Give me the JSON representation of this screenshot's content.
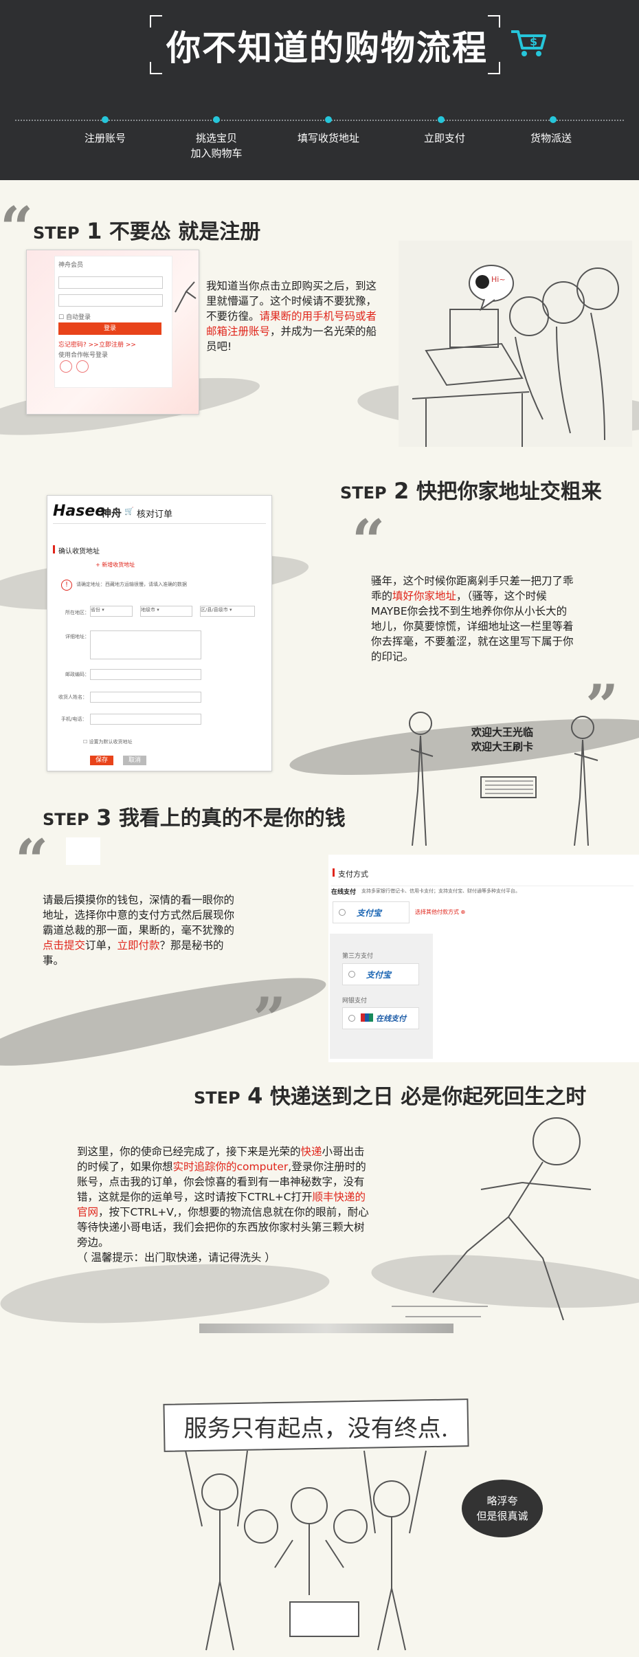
{
  "header": {
    "title": "你不知道的购物流程",
    "cart_icon": "shopping-cart-icon",
    "accent_color": "#26c6da",
    "steps": [
      {
        "label": "注册账号"
      },
      {
        "label": "挑选宝贝",
        "label2": "加入购物车"
      },
      {
        "label": "填写收货地址"
      },
      {
        "label": "立即支付"
      },
      {
        "label": "货物派送"
      }
    ]
  },
  "step1": {
    "step_word": "STEP",
    "num": "1",
    "title": "不要怂 就是注册",
    "text_a": "我知道当你点击立即购买之后，到这里就懵逼了。这个时候请不要犹豫，不要彷徨。",
    "text_red": "请果断的用手机号码或者邮箱注册账号",
    "text_b": "，并成为一名光荣的船员吧!",
    "shot": {
      "member_label": "神舟会员",
      "auto_login": "自动登录",
      "login_button": "登录",
      "forgot": "忘记密码? >>",
      "register": "立即注册 >>",
      "partner": "使用合作帐号登录"
    },
    "qq_label": "Hi~"
  },
  "step2": {
    "step_word": "STEP",
    "num": "2",
    "title": "快把你家地址交粗来",
    "text_a": "骚年，这个时候你距离剁手只差一把刀了乖乖的",
    "text_red": "填好你家地址",
    "text_b": "，（骚等，这个时候MAYBE你会找不到生地养你你从小长大的地儿，你莫要惊慌，详细地址这一栏里等着你去挥毫，不要羞涩，就在这里写下属于你的印记。",
    "shot": {
      "brand": "Hasee",
      "brand_cn": "神舟",
      "check_order": "核对订单",
      "section": "确认收货地址",
      "new_address": "+ 新增收货地址",
      "notice": "请确定地址：西藏地方运输很慢，请填入准确的数据",
      "region_label": "所在地区：",
      "province": "省份",
      "city": "地级市",
      "district": "区/县/县级市",
      "detail_label": "详细地址：",
      "zip_label": "邮政编码：",
      "name_label": "收货人姓名：",
      "phone_label": "手机/电话：",
      "default_label": "设置为默认收货地址",
      "save": "保存",
      "cancel": "取消"
    },
    "welcome_1": "欢迎大王光临",
    "welcome_2": "欢迎大王刷卡"
  },
  "step3": {
    "step_word": "STEP",
    "num": "3",
    "title": "我看上的真的不是你的钱",
    "text_a": "请最后摸摸你的钱包，深情的看一眼你的地址，选择你中意的支付方式然后展现你霸道总裁的那一面，果断的，毫不犹豫的",
    "text_red1": "点击提交",
    "text_b": "订单，",
    "text_red2": "立即付款",
    "text_c": "？那是秘书的事。",
    "shot": {
      "section": "支付方式",
      "online_label": "在线支付",
      "online_desc": "支持多家银行借记卡、信用卡支付；支持支付宝、财付通等多种支付平台。",
      "alipay": "支付宝",
      "choose_other": "选择其他付款方式",
      "third_party": "第三方支付",
      "bank_pay": "网银支付",
      "unionpay": "在线支付"
    }
  },
  "step4": {
    "step_word": "STEP",
    "num": "4",
    "title": "快递送到之日 必是你起死回生之时",
    "text_a": "到这里，你的使命已经完成了，接下来是光荣的",
    "text_red1": "快递",
    "text_b": "小哥出击的时候了，如果你想",
    "text_red2": "实时追踪你的computer",
    "text_c": ",登录你注册时的账号，点击我的订单，你会惊喜的看到有一串神秘数字，没有错，这就是你的运单号，这时请按下CTRL+C打开",
    "text_red3": "顺丰快递的官网",
    "text_d": "，按下CTRL+V,，你想要的物流信息就在你的眼前，耐心等待快递小哥电话，我们会把你的东西放你家村头第三颗大树旁边。",
    "text_e": "（ 温馨提示：出门取快递，请记得洗头 ）"
  },
  "footer": {
    "banner": "服务只有起点，没有终点.",
    "bubble_1": "略浮夸",
    "bubble_2": "但是很真诚"
  }
}
